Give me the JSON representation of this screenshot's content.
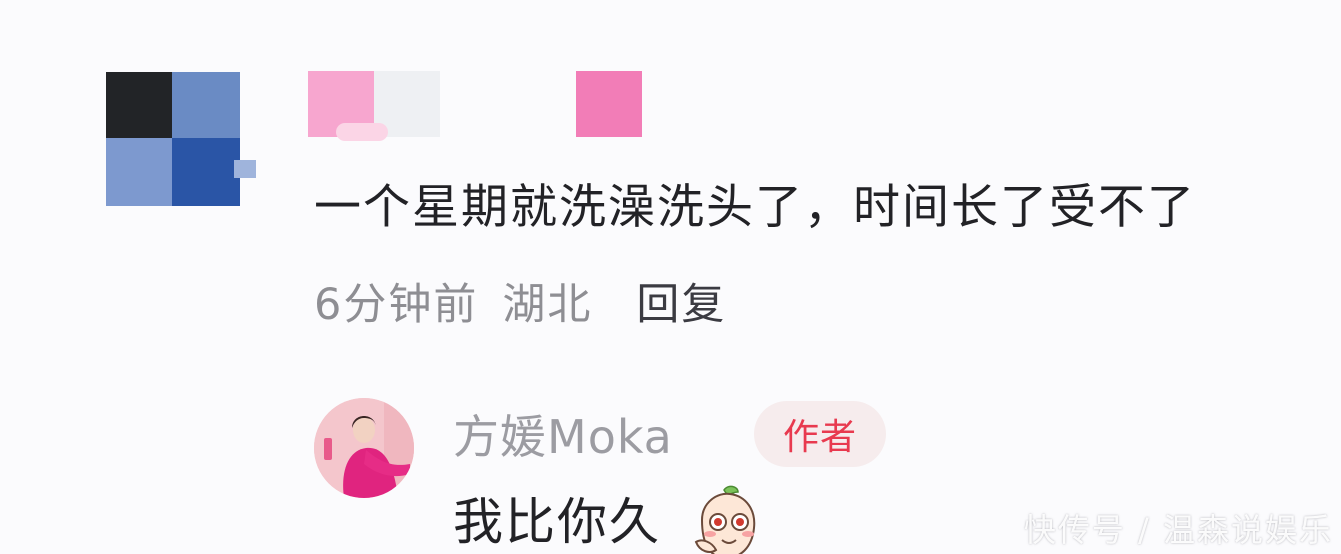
{
  "comment": {
    "text": "一个星期就洗澡洗头了，时间长了受不了",
    "time": "6分钟前",
    "location": "湖北",
    "reply_label": "回复"
  },
  "author_reply": {
    "name": "方媛Moka",
    "badge": "作者",
    "text": "我比你久",
    "emoji_icon": "shy-peach-emoji-icon"
  },
  "watermark": "快传号 / 温森说娱乐",
  "colors": {
    "badge_text": "#e83a4f",
    "badge_bg": "#f6eced",
    "meta_text": "#8e8e93",
    "name_text": "#9c9ca2"
  }
}
